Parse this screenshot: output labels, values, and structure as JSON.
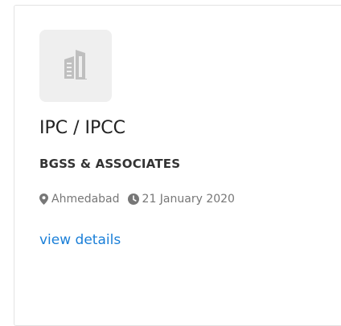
{
  "listing": {
    "logo_icon": "building-icon",
    "title": "IPC / IPCC",
    "company": "BGSS & ASSOCIATES",
    "location_icon": "map-marker-icon",
    "location": "Ahmedabad",
    "date_icon": "clock-icon",
    "date": "21 January 2020",
    "details_link": "view details",
    "link_color": "#1a7fd8"
  }
}
